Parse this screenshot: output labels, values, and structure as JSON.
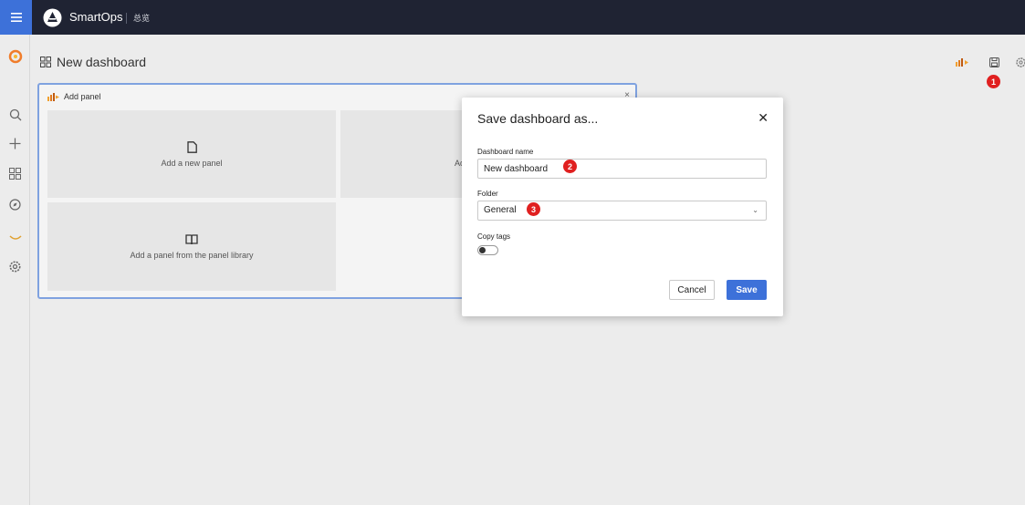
{
  "topbar": {
    "app_name": "SmartOps",
    "app_subtitle": "总览",
    "menu_icon": "hamburger-icon",
    "logo_icon": "smartops-logo",
    "accent": "#3d71d9",
    "bar_color": "#1f2333"
  },
  "sidebar": {
    "icons": [
      "grafana-logo",
      "search-icon",
      "plus-icon",
      "dashboards-icon",
      "explore-icon",
      "alerting-icon",
      "settings-icon"
    ]
  },
  "page": {
    "title": "New dashboard",
    "actions": [
      "add-panel-icon",
      "save-icon",
      "settings-icon"
    ]
  },
  "add_panel": {
    "title": "Add panel",
    "tiles": [
      {
        "label": "Add a new panel",
        "icon": "file-icon"
      },
      {
        "label": "Ad",
        "icon": ""
      },
      {
        "label": "Add a panel from the panel library",
        "icon": "book-icon"
      }
    ]
  },
  "modal": {
    "title": "Save dashboard as...",
    "dashboard_name_label": "Dashboard name",
    "dashboard_name_value": "New dashboard",
    "folder_label": "Folder",
    "folder_value": "General",
    "copy_tags_label": "Copy tags",
    "copy_tags_on": false,
    "cancel_label": "Cancel",
    "save_label": "Save"
  },
  "markers": [
    "1",
    "2",
    "3"
  ],
  "colors": {
    "marker": "#e02020",
    "primary_button": "#3d71d9",
    "panel_border": "#7fa2e0"
  }
}
